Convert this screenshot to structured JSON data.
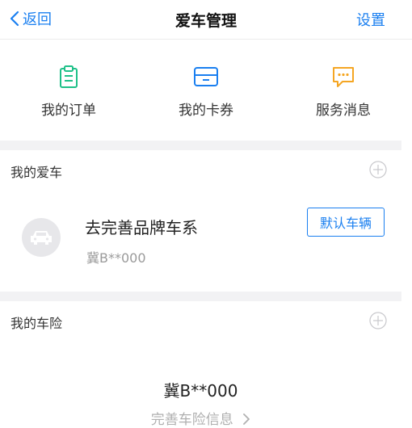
{
  "nav": {
    "back_label": "返回",
    "title": "爱车管理",
    "settings_label": "设置"
  },
  "quick_actions": [
    {
      "label": "我的订单",
      "icon": "clipboard-icon",
      "color": "#1ec088"
    },
    {
      "label": "我的卡券",
      "icon": "card-icon",
      "color": "#1a7ff0"
    },
    {
      "label": "服务消息",
      "icon": "message-icon",
      "color": "#f5a623"
    }
  ],
  "my_cars": {
    "title": "我的爱车",
    "car": {
      "name": "去完善品牌车系",
      "plate": "冀B**000",
      "default_label": "默认车辆"
    }
  },
  "my_insurance": {
    "title": "我的车险",
    "plate": "冀B**000",
    "link_label": "完善车险信息"
  },
  "colors": {
    "accent": "#1a7ff0",
    "section_bg": "#f2f2f4"
  }
}
